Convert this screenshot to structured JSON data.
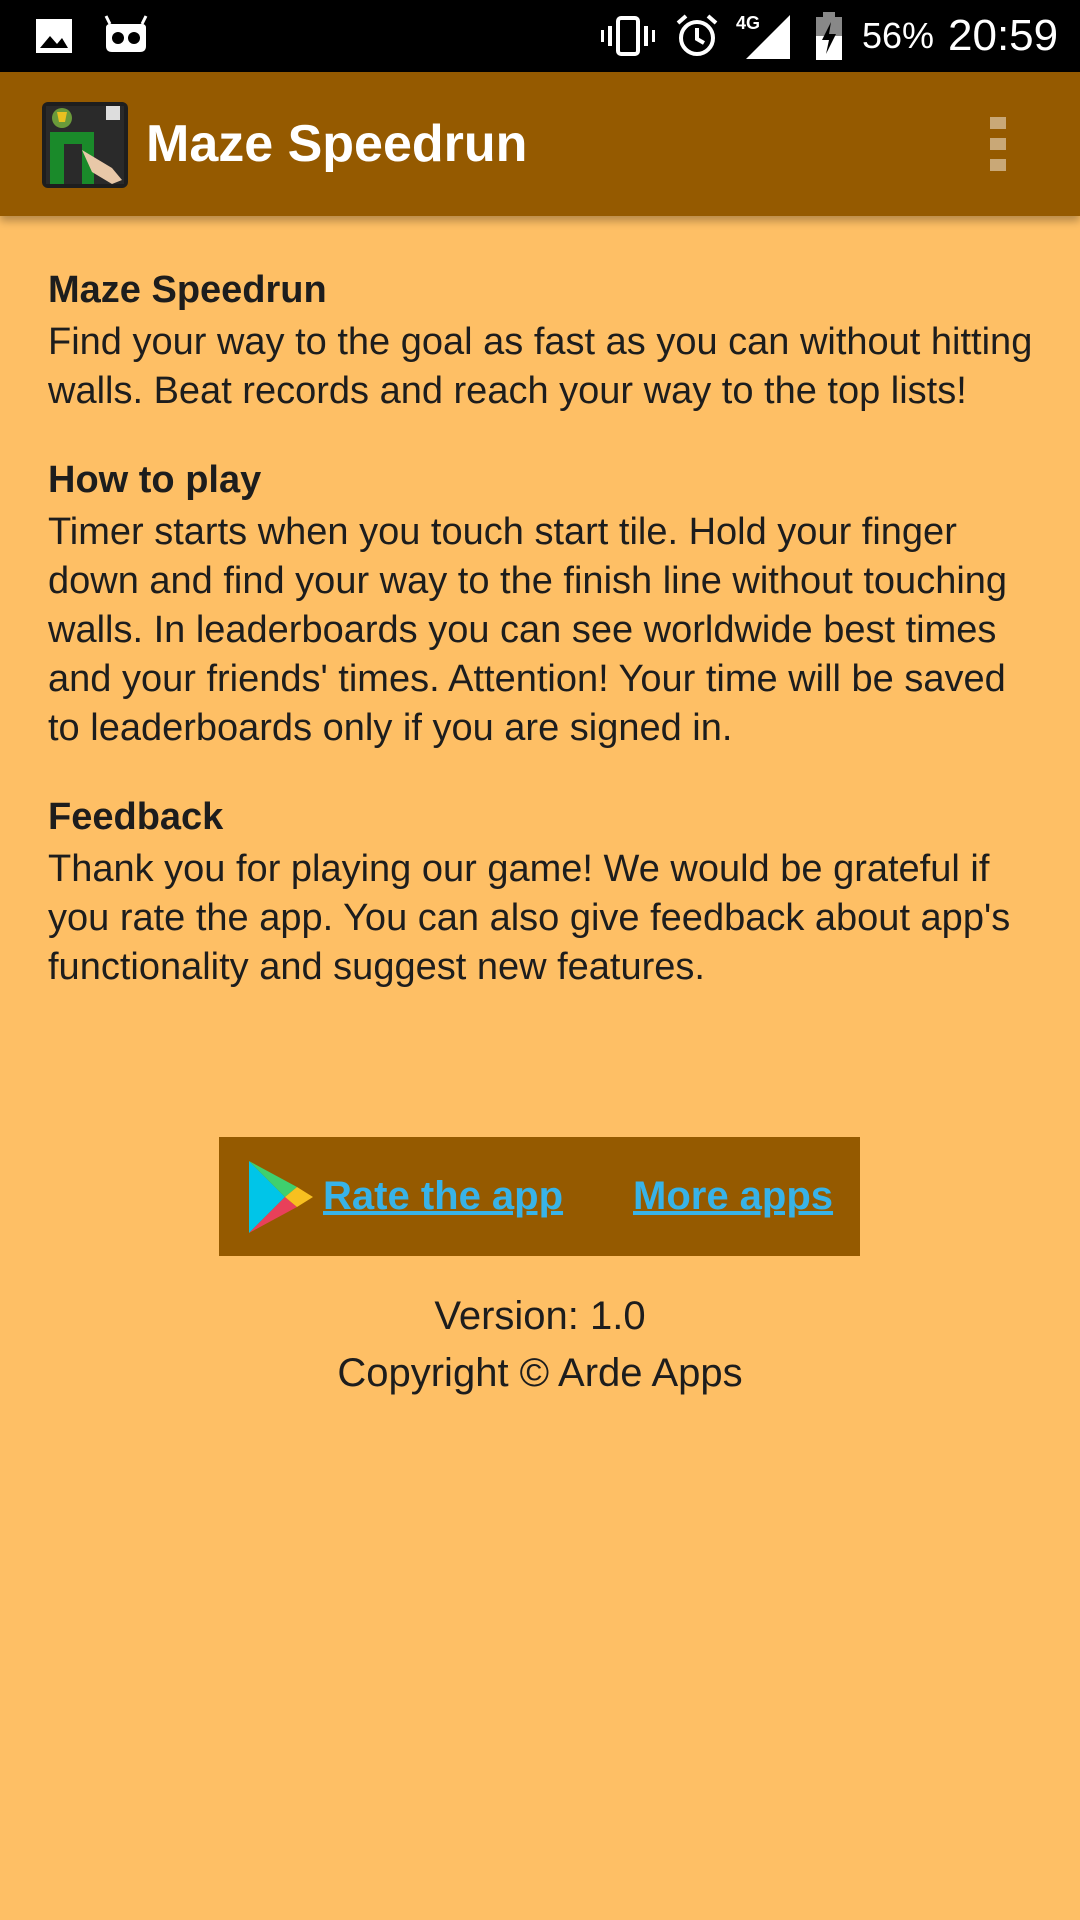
{
  "status_bar": {
    "battery_percent": "56%",
    "time": "20:59",
    "network": "4G",
    "icons": [
      "gallery-icon",
      "android-debug-icon",
      "vibrate-icon",
      "alarm-icon",
      "signal-icon",
      "battery-icon"
    ]
  },
  "app_bar": {
    "title": "Maze Speedrun",
    "icons": [
      "app-logo-icon",
      "overflow-menu-icon"
    ]
  },
  "sections": [
    {
      "heading": "Maze Speedrun",
      "body": "Find your way to the goal as fast as you can without hitting walls. Beat records and reach your way to the top lists!"
    },
    {
      "heading": "How to play",
      "body": "Timer starts when you touch start tile. Hold your finger down and find your way to the finish line without touching walls. In leaderboards you can see worldwide best times and your friends' times. Attention! Your time will be saved to leaderboards only if you are signed in."
    },
    {
      "heading": "Feedback",
      "body": "Thank you for playing our game! We would be grate­ful if you rate the app. You can also give feedback about app's functionality and suggest new features."
    }
  ],
  "buttons": {
    "rate_label": "Rate the app",
    "more_label": "More apps",
    "icon": "google-play-icon"
  },
  "footer": {
    "version": "Version: 1.0",
    "copyright": "Copyright © Arde Apps"
  },
  "colors": {
    "background": "#FEBF65",
    "app_bar": "#955A00",
    "link": "#38B3E8",
    "status_bar": "#000000"
  }
}
